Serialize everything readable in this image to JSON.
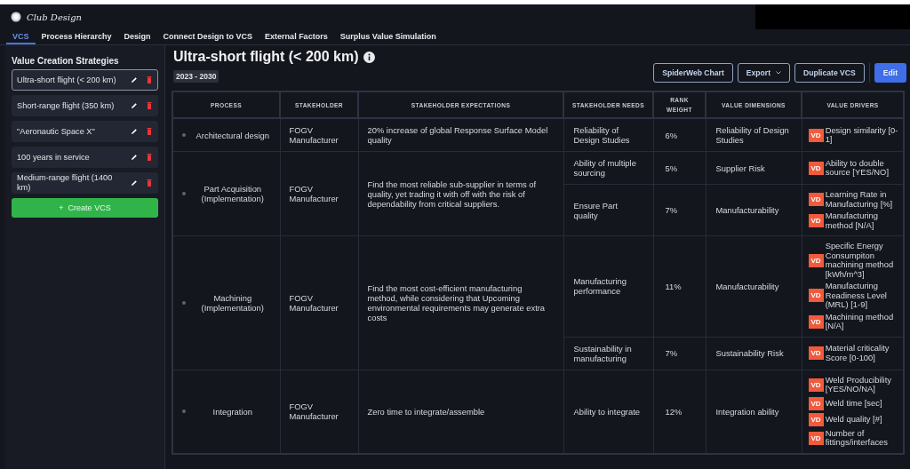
{
  "app": {
    "title": "Club Design"
  },
  "tabs": [
    {
      "label": "VCS",
      "selected": true
    },
    {
      "label": "Process Hierarchy",
      "selected": false
    },
    {
      "label": "Design",
      "selected": false
    },
    {
      "label": "Connect Design to VCS",
      "selected": false
    },
    {
      "label": "External Factors",
      "selected": false
    },
    {
      "label": "Surplus Value Simulation",
      "selected": false
    }
  ],
  "sidebar": {
    "title": "Value Creation Strategies",
    "items": [
      {
        "label": "Ultra-short flight (< 200 km)",
        "selected": true
      },
      {
        "label": "Short-range flight (350 km)",
        "selected": false
      },
      {
        "label": "\"Aeronautic Space X\"",
        "selected": false
      },
      {
        "label": "100 years in service",
        "selected": false
      },
      {
        "label": "Medium-range flight (1400 km)",
        "selected": false
      }
    ],
    "create_button": "+  Create VCS"
  },
  "main": {
    "title": "Ultra-short flight (< 200 km)",
    "period": "2023 - 2030",
    "buttons": [
      {
        "label": "SpiderWeb Chart",
        "kind": "outline"
      },
      {
        "label": "Export",
        "kind": "dropdown"
      },
      {
        "label": "Duplicate VCS",
        "kind": "outline"
      },
      {
        "label": "Edit",
        "kind": "primary"
      }
    ]
  },
  "table": {
    "columns": [
      "PROCESS",
      "STAKEHOLDER",
      "STAKEHOLDER EXPECTATIONS",
      "STAKEHOLDER NEEDS",
      "RANK WEIGHT",
      "VALUE DIMENSIONS",
      "VALUE DRIVERS"
    ],
    "rows": [
      {
        "process": "Architectural design",
        "stakeholder": "FOGV Manufacturer",
        "expectations": "20% increase of global Response Surface Model quality",
        "needs": [
          {
            "need": "Reliability of Design Studies",
            "rank_weight": "6%",
            "dimension": "Reliability of Design Studies",
            "drivers": [
              {
                "badge": "VD",
                "label": "Design similarity [0-1]"
              }
            ]
          }
        ]
      },
      {
        "process": "Part Acquisition (Implementation)",
        "stakeholder": "FOGV Manufacturer",
        "expectations": "Find the most reliable sub-supplier in terms of quality, yet trading it with off with the risk of dependability from critical suppliers.",
        "needs": [
          {
            "need": "Ability of multiple sourcing",
            "rank_weight": "5%",
            "dimension": "Supplier Risk",
            "drivers": [
              {
                "badge": "VD",
                "label": "Ability to double source [YES/NO]"
              }
            ]
          },
          {
            "need": "Ensure Part quality",
            "rank_weight": "7%",
            "dimension": "Manufacturability",
            "drivers": [
              {
                "badge": "VD",
                "label": "Learning Rate in Manufacturing [%]"
              },
              {
                "badge": "VD",
                "label": "Manufacturing method [N/A]"
              }
            ]
          }
        ]
      },
      {
        "process": "Machining (Implementation)",
        "stakeholder": "FOGV Manufacturer",
        "expectations": "Find the most cost-efficient manufacturing method, while considering that Upcoming environmental requirements may generate extra costs",
        "needs": [
          {
            "need": "Manufacturing performance",
            "rank_weight": "11%",
            "dimension": "Manufacturability",
            "drivers": [
              {
                "badge": "VD",
                "label": "Specific Energy Consumpiton machining method [kWh/m^3]"
              },
              {
                "badge": "VD",
                "label": "Manufacturing Readiness Level (MRL) [1-9]"
              },
              {
                "badge": "VD",
                "label": "Machining method [N/A]"
              }
            ]
          },
          {
            "need": "Sustainability in manufacturing",
            "rank_weight": "7%",
            "dimension": "Sustainability Risk",
            "drivers": [
              {
                "badge": "VD",
                "label": "Material criticality Score [0-100]"
              }
            ]
          }
        ]
      },
      {
        "process": "Integration",
        "stakeholder": "FOGV Manufacturer",
        "expectations": "Zero time to integrate/assemble",
        "needs": [
          {
            "need": "Ability to integrate",
            "rank_weight": "12%",
            "dimension": "Integration ability",
            "drivers": [
              {
                "badge": "VD",
                "label": "Weld Producibility [YES/NO/NA]"
              },
              {
                "badge": "VD",
                "label": "Weld time [sec]"
              },
              {
                "badge": "VD",
                "label": "Weld quality [#]"
              },
              {
                "badge": "VD",
                "label": "Number of fittings/interfaces"
              }
            ]
          }
        ]
      }
    ]
  }
}
